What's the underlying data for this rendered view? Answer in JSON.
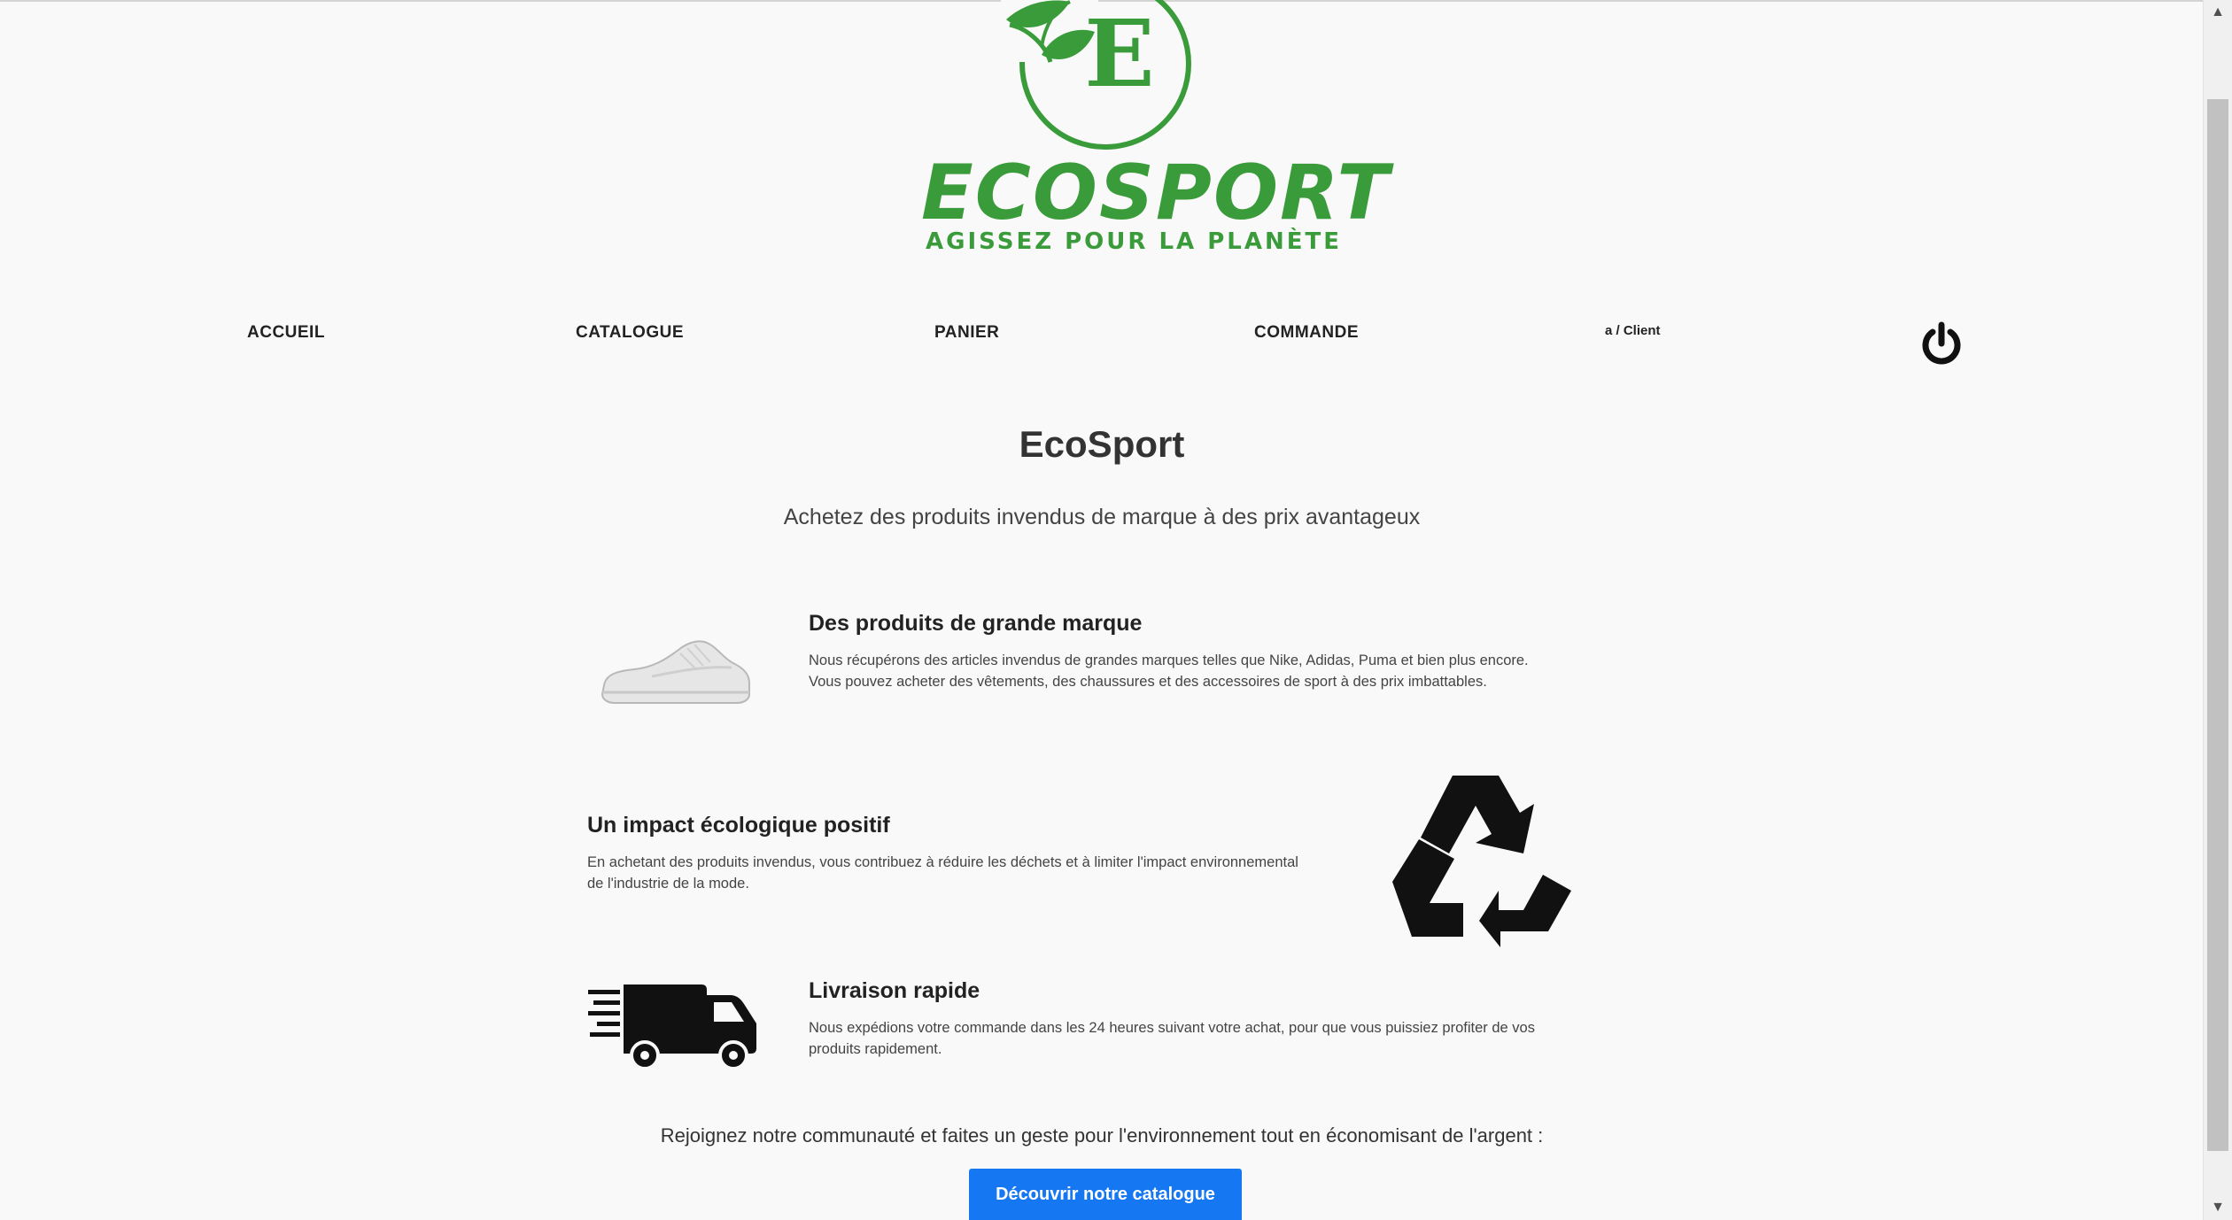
{
  "brand": {
    "logo_text": "ECOSPORT",
    "logo_monogram": "E",
    "slogan": "AGISSEZ POUR LA PLANÈTE",
    "color": "#3a9b3a"
  },
  "nav": {
    "items": [
      "ACCUEIL",
      "CATALOGUE",
      "PANIER",
      "COMMANDE"
    ],
    "user": "a / Client",
    "logout_icon": "power-icon"
  },
  "hero": {
    "title": "EcoSport",
    "subtitle": "Achetez des produits invendus de marque à des prix avantageux"
  },
  "features": [
    {
      "icon": "sneaker-image",
      "title": "Des produits de grande marque",
      "lines": [
        "Nous récupérons des articles invendus de grandes marques telles que Nike, Adidas, Puma et bien plus encore.",
        "Vous pouvez acheter des vêtements, des chaussures et des accessoires de sport à des prix imbattables."
      ]
    },
    {
      "icon": "recycle-icon",
      "title": "Un impact écologique positif",
      "lines": [
        "En achetant des produits invendus, vous contribuez à réduire les déchets et à limiter l'impact environnemental",
        "de l'industrie de la mode."
      ]
    },
    {
      "icon": "delivery-truck-icon",
      "title": "Livraison rapide",
      "lines": [
        "Nous expédions votre commande dans les 24 heures suivant votre achat, pour que vous puissiez profiter de vos",
        "produits rapidement."
      ]
    }
  ],
  "cta": {
    "text": "Rejoignez notre communauté et faites un geste pour l'environnement tout en économisant de l'argent :",
    "button": "Découvrir notre catalogue",
    "button_color": "#1577f2"
  }
}
